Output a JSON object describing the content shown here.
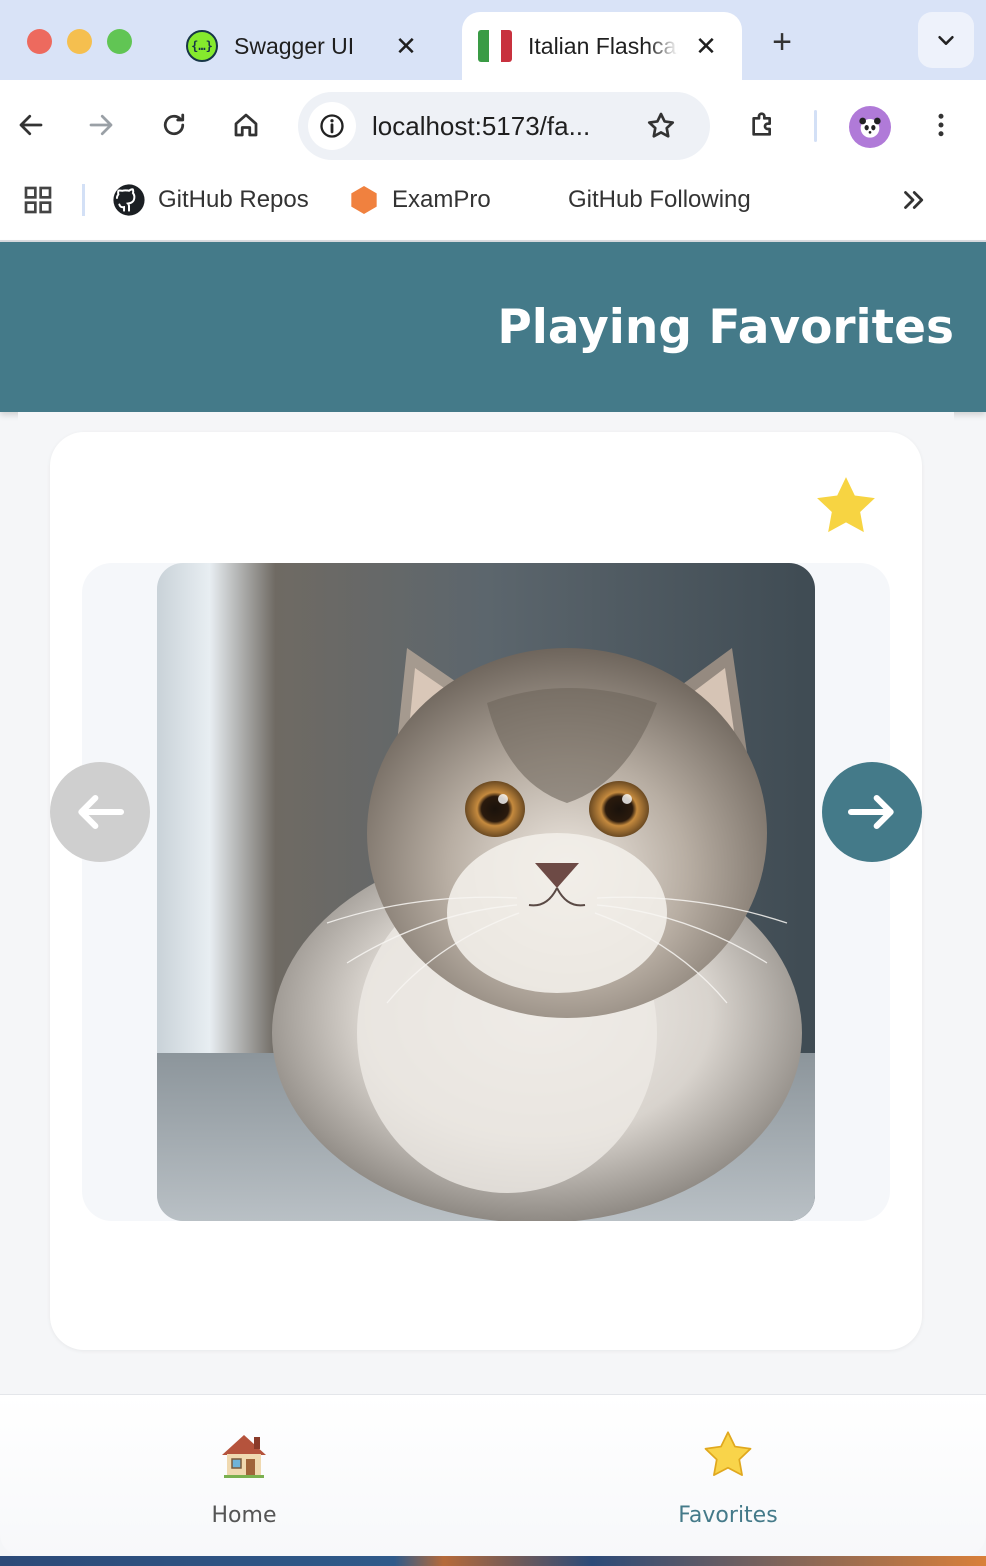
{
  "browser": {
    "tabs": [
      {
        "title": "Swagger UI",
        "icon": "swagger-icon",
        "active": false
      },
      {
        "title": "Italian Flashcards",
        "icon": "italian-flag-icon",
        "active": true
      }
    ],
    "swagger_glyph": "{…}",
    "url": "localhost:5173/fa...",
    "bookmarks": [
      {
        "label": "GitHub Repos",
        "icon": "github-icon"
      },
      {
        "label": "ExamPro",
        "icon": "hexagon-icon"
      },
      {
        "label": "GitHub Following",
        "icon": ""
      }
    ],
    "colors": {
      "tabbar": "#d9e3f7",
      "flag_green": "#3a9b45",
      "flag_white": "#ffffff",
      "flag_red": "#c8313e"
    }
  },
  "app": {
    "title": "Playing Favorites",
    "header_color": "#447a89",
    "card": {
      "favorite_icon": "star-icon",
      "favorite_color": "#f7d442",
      "image_subject": "fluffy grey and white cat",
      "prev_icon": "arrow-left-icon",
      "next_icon": "arrow-right-icon"
    },
    "bottom_nav": [
      {
        "label": "Home",
        "icon": "house-icon",
        "active": false
      },
      {
        "label": "Favorites",
        "icon": "star-icon",
        "active": true
      }
    ]
  }
}
